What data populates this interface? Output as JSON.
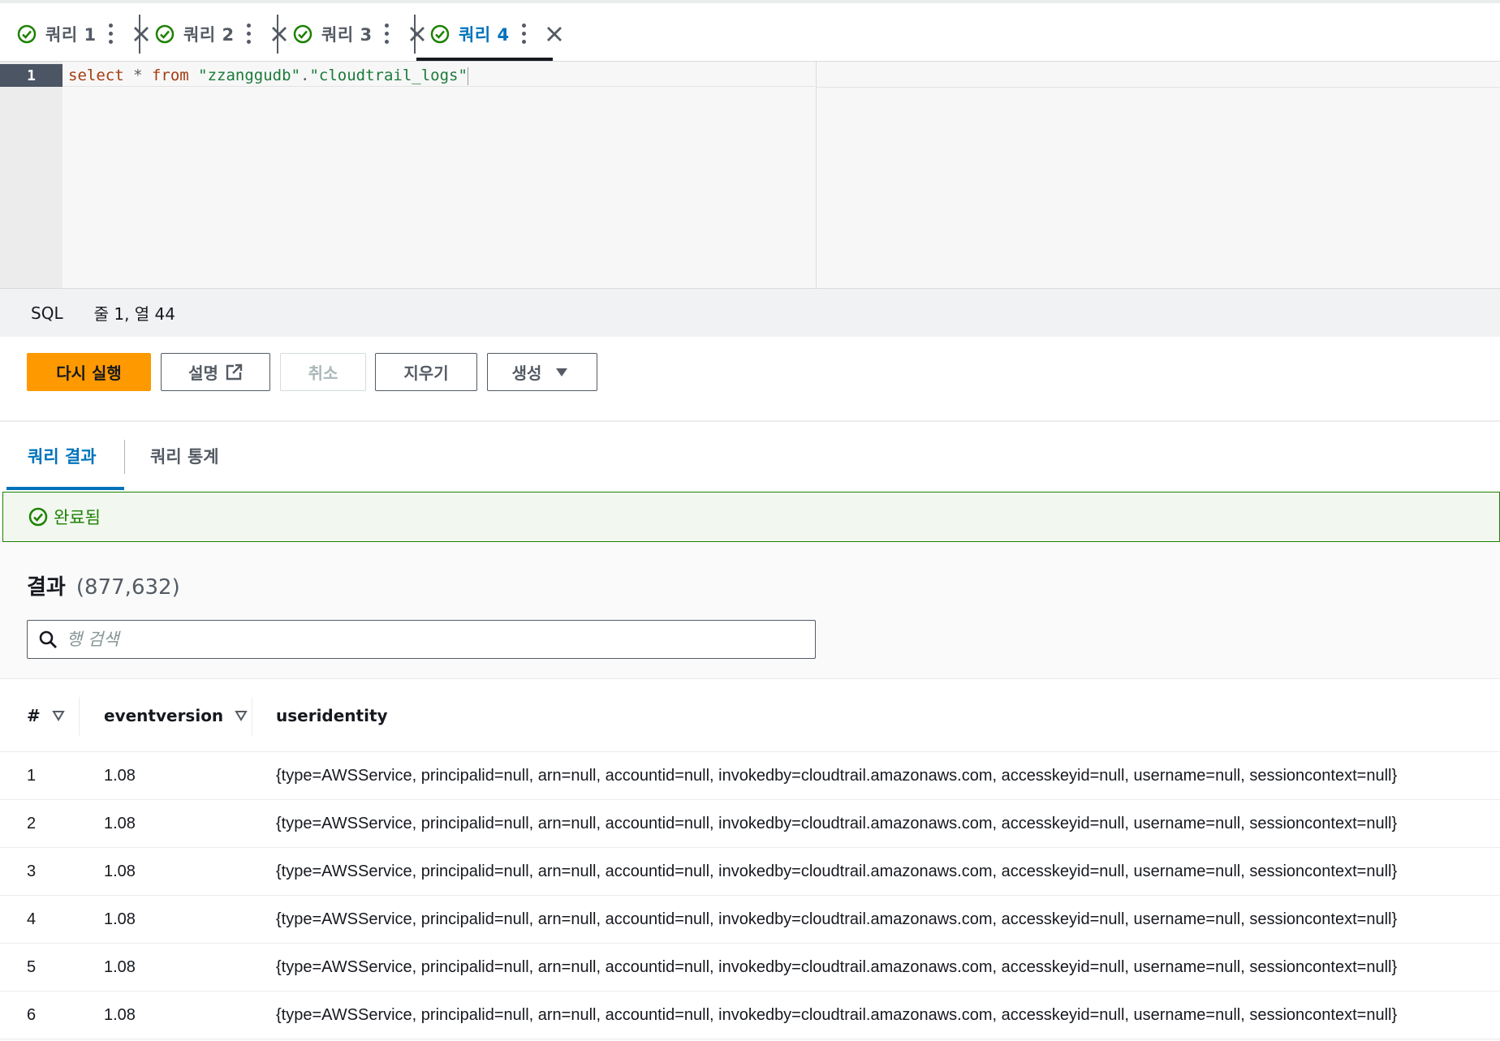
{
  "tabs": [
    {
      "label": "쿼리 1",
      "active": false
    },
    {
      "label": "쿼리 2",
      "active": false
    },
    {
      "label": "쿼리 3",
      "active": false
    },
    {
      "label": "쿼리 4",
      "active": true
    }
  ],
  "editor": {
    "line_number": "1",
    "code": {
      "kw_select": "select",
      "op_star": " * ",
      "kw_from": "from",
      "str_db": " \"zzanggudb\"",
      "op_dot": ".",
      "str_table": "\"cloudtrail_logs\""
    }
  },
  "status": {
    "language": "SQL",
    "position": "줄 1, 열 44"
  },
  "actions": {
    "run_again": "다시 실행",
    "explain": "설명",
    "cancel": "취소",
    "clear": "지우기",
    "create": "생성"
  },
  "result_tabs": {
    "results": "쿼리 결과",
    "stats": "쿼리 통계"
  },
  "banner": {
    "text": "완료됨"
  },
  "results": {
    "title": "결과",
    "count": "(877,632)",
    "search_placeholder": "행 검색",
    "columns": [
      "#",
      "eventversion",
      "useridentity"
    ],
    "rows": [
      {
        "n": "1",
        "eventversion": "1.08",
        "useridentity": "{type=AWSService, principalid=null, arn=null, accountid=null, invokedby=cloudtrail.amazonaws.com, accesskeyid=null, username=null, sessioncontext=null}"
      },
      {
        "n": "2",
        "eventversion": "1.08",
        "useridentity": "{type=AWSService, principalid=null, arn=null, accountid=null, invokedby=cloudtrail.amazonaws.com, accesskeyid=null, username=null, sessioncontext=null}"
      },
      {
        "n": "3",
        "eventversion": "1.08",
        "useridentity": "{type=AWSService, principalid=null, arn=null, accountid=null, invokedby=cloudtrail.amazonaws.com, accesskeyid=null, username=null, sessioncontext=null}"
      },
      {
        "n": "4",
        "eventversion": "1.08",
        "useridentity": "{type=AWSService, principalid=null, arn=null, accountid=null, invokedby=cloudtrail.amazonaws.com, accesskeyid=null, username=null, sessioncontext=null}"
      },
      {
        "n": "5",
        "eventversion": "1.08",
        "useridentity": "{type=AWSService, principalid=null, arn=null, accountid=null, invokedby=cloudtrail.amazonaws.com, accesskeyid=null, username=null, sessioncontext=null}"
      },
      {
        "n": "6",
        "eventversion": "1.08",
        "useridentity": "{type=AWSService, principalid=null, arn=null, accountid=null, invokedby=cloudtrail.amazonaws.com, accesskeyid=null, username=null, sessioncontext=null}"
      }
    ]
  },
  "colors": {
    "accent": "#0073bb",
    "primary_button": "#ff9900",
    "success": "#1d8102",
    "success_bg": "#f2f8f0"
  },
  "icons": {
    "tab_status": "check-circle-icon",
    "tab_menu": "kebab-menu-icon",
    "tab_close": "close-icon",
    "explain": "external-link-icon",
    "create": "caret-down-icon",
    "banner": "check-circle-icon",
    "search": "search-icon",
    "sort": "sort-down-icon"
  }
}
